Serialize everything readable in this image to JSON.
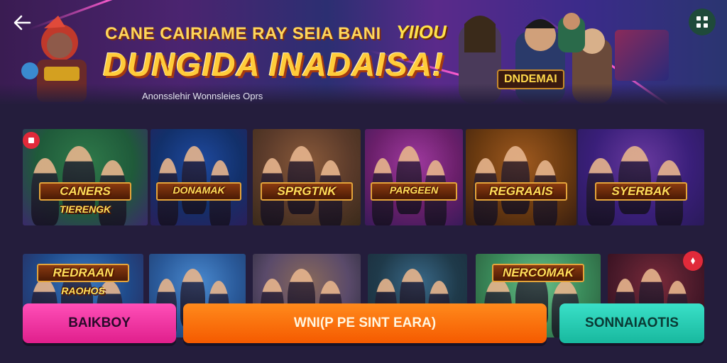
{
  "banner": {
    "title": "CANE CAIRIAME RAY SEIA BANI",
    "headline": "DUNGIDA INADAISA!",
    "subtitle": "Anonsslehir Wonnsleies Oprs",
    "logo_text": "YIIOU",
    "hero_badge": "DNDEMAI"
  },
  "icons": {
    "back": "back-arrow-icon",
    "menu": "grid-menu-icon"
  },
  "games_row1": [
    {
      "label": "CANERS",
      "sub": "TIERENGK",
      "colors": [
        "#1f5a3a",
        "#2f7a4a",
        "#3a2a6a"
      ]
    },
    {
      "label": "DONAMAK",
      "sub": "",
      "colors": [
        "#12306a",
        "#1f4aa0",
        "#2a1f5a"
      ]
    },
    {
      "label": "SPRGTNK",
      "sub": "",
      "colors": [
        "#5a3a2a",
        "#8a5a3a",
        "#3a2a1a"
      ]
    },
    {
      "label": "PARGEEN",
      "sub": "",
      "colors": [
        "#6a1f6a",
        "#a03aa0",
        "#3a1a5a"
      ]
    },
    {
      "label": "REGRAAIS",
      "sub": "",
      "colors": [
        "#6a3a10",
        "#a05a1f",
        "#3a1f10"
      ]
    },
    {
      "label": "SYERBAK",
      "sub": "",
      "colors": [
        "#3a1f7a",
        "#6a3aa0",
        "#2a1a5a"
      ]
    }
  ],
  "games_row2": [
    {
      "label": "REDRAAN",
      "sub": "RAOHOS",
      "colors": [
        "#1f4a8a",
        "#3a7ac0",
        "#2a2a5a"
      ]
    },
    {
      "label": "",
      "sub": "",
      "colors": [
        "#2a5a9a",
        "#4a8ad0",
        "#1f3a6a"
      ]
    },
    {
      "label": "",
      "sub": "",
      "colors": [
        "#5a4a6a",
        "#8a6a5a",
        "#2a2a3a"
      ]
    },
    {
      "label": "",
      "sub": "",
      "colors": [
        "#1f3a4a",
        "#3a6a8a",
        "#1a2a3a"
      ]
    },
    {
      "label": "NERCOMAK",
      "sub": "",
      "colors": [
        "#3a8a5a",
        "#6ac08a",
        "#2a5a3a"
      ]
    },
    {
      "label": "",
      "sub": "",
      "colors": [
        "#4a1a2a",
        "#7a2a3a",
        "#2a0a1a"
      ]
    }
  ],
  "actions": {
    "left": "BAIKBOY",
    "center": "WNI(P PE SINT EARA)",
    "right": "SONNAIAOTIS"
  }
}
